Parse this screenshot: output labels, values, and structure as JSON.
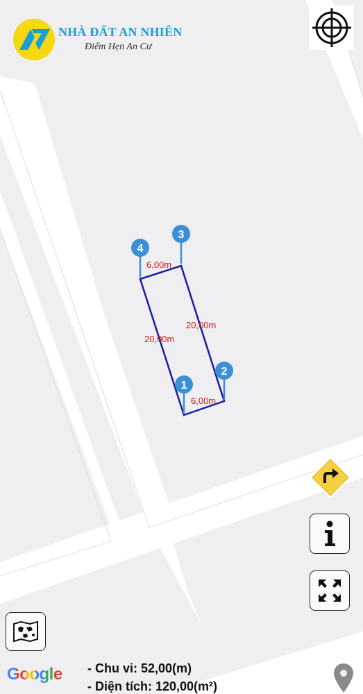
{
  "brand": {
    "name": "NHÀ ĐẤT AN NHIÊN",
    "slogan": "Điểm Hẹn An Cư",
    "logo_icon": "logo-triangle-icon",
    "colors": {
      "primary": "#1a9fd6",
      "logo_bg": "#f5d90f"
    }
  },
  "map": {
    "background": "#efeff2",
    "road_color": "#ffffff",
    "parcel_outline": "#1a1aa8",
    "label_color": "#d11a1a",
    "marker_color": "#3b8fd6"
  },
  "parcel": {
    "markers": [
      "1",
      "2",
      "3",
      "4"
    ],
    "edge_labels": {
      "top": "6,00m",
      "bottom": "6,00m",
      "left": "20,00m",
      "right": "20,00m"
    }
  },
  "controls": {
    "locate_icon": "crosshair-icon",
    "directions_icon": "turn-right-sign-icon",
    "info_icon": "info-icon",
    "fullscreen_icon": "expand-icon",
    "map_layers_icon": "map-icon"
  },
  "footer": {
    "perimeter": "- Chu vi: 52,00(m)",
    "area": "- Diện tích: 120,00(m²)",
    "google": "Google",
    "location_icon": "location-pin-icon"
  }
}
